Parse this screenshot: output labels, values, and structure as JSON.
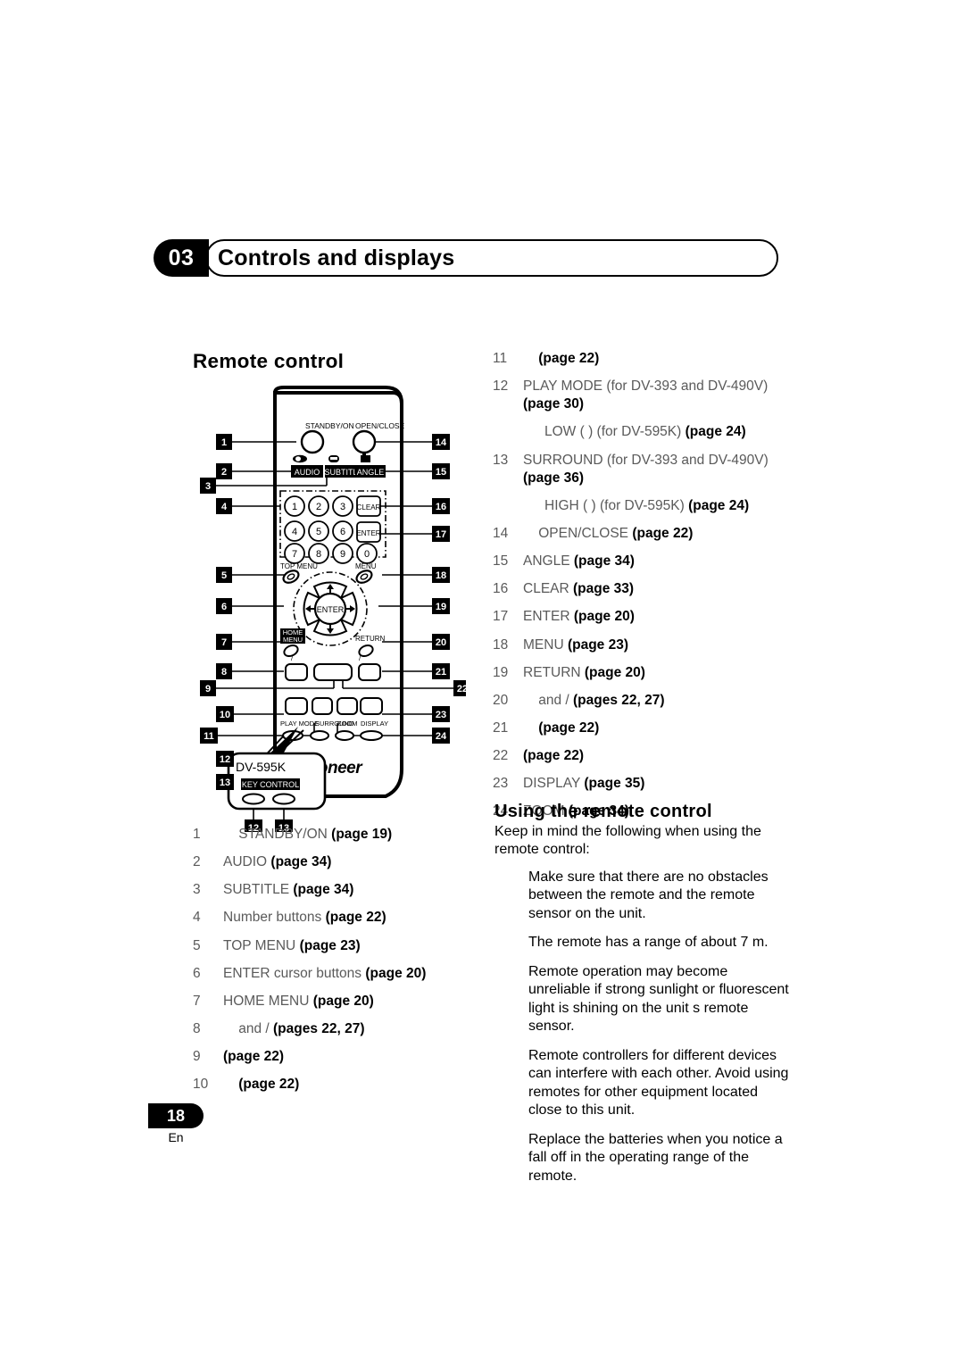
{
  "chapter": {
    "number": "03",
    "title": "Controls and displays"
  },
  "sections": {
    "remote_control": "Remote control",
    "using_remote_control": "Using the remote control"
  },
  "left_list": [
    {
      "n": "1",
      "text": "STANDBY/ON",
      "page": "(page 19)",
      "lead": true
    },
    {
      "n": "2",
      "text": "AUDIO",
      "page": "(page 34)"
    },
    {
      "n": "3",
      "text": "SUBTITLE",
      "page": "(page 34)"
    },
    {
      "n": "4",
      "text": "Number buttons",
      "page": "(page 22)"
    },
    {
      "n": "5",
      "text": "TOP MENU",
      "page": "(page 23)"
    },
    {
      "n": "6",
      "text": "ENTER    cursor buttons",
      "page": "(page 20)"
    },
    {
      "n": "7",
      "text": "HOME MENU",
      "page": "(page 20)"
    },
    {
      "n": "8",
      "text": "and  /",
      "page": "(pages 22, 27)",
      "lead": true
    },
    {
      "n": "9",
      "text": "",
      "page": "(page 22)"
    },
    {
      "n": "10",
      "text": "",
      "page": "(page 22)",
      "lead": true
    }
  ],
  "right_list": [
    {
      "n": "11",
      "text": "",
      "page": "(page 22)",
      "lead": true
    },
    {
      "n": "12",
      "text": "PLAY MODE (for DV-393 and DV-490V)",
      "page": "(page 30)",
      "wrap": true
    },
    {
      "n": "",
      "text": "LOW (  ) (for DV-595K)",
      "page": "(page 24)",
      "sub": true
    },
    {
      "n": "13",
      "text": "SURROUND (for DV-393 and DV-490V)",
      "page": "(page 36)",
      "wrap": true
    },
    {
      "n": "",
      "text": "HIGH (  ) (for DV-595K)",
      "page": "(page 24)",
      "sub": true
    },
    {
      "n": "14",
      "text": "OPEN/CLOSE",
      "page": "(page 22)",
      "lead": true
    },
    {
      "n": "15",
      "text": "ANGLE",
      "page": "(page 34)"
    },
    {
      "n": "16",
      "text": "CLEAR",
      "page": "(page 33)"
    },
    {
      "n": "17",
      "text": "ENTER",
      "page": "(page 20)"
    },
    {
      "n": "18",
      "text": "MENU",
      "page": "(page 23)"
    },
    {
      "n": "19",
      "text": "RETURN",
      "page": "(page 20)"
    },
    {
      "n": "20",
      "text": "and  /",
      "page": "(pages 22, 27)",
      "lead": true
    },
    {
      "n": "21",
      "text": "",
      "page": "(page 22)",
      "lead": true
    },
    {
      "n": "22",
      "text": "",
      "page": "(page 22)"
    },
    {
      "n": "23",
      "text": "DISPLAY",
      "page": "(page 35)"
    },
    {
      "n": "24",
      "text": "ZOOM",
      "page": "(page 34)"
    }
  ],
  "using_remote": {
    "intro": "Keep in mind the following when using the remote control:",
    "bullets": [
      "Make sure that there are no obstacles between the remote and the remote sensor on the unit.",
      "The remote has a range of about 7 m.",
      "Remote operation may become unreliable if strong sunlight or fluorescent light is shining on the unit s remote sensor.",
      "Remote controllers for different devices can interfere with each other. Avoid using remotes for other equipment located close to this unit.",
      "Replace the batteries when you notice a fall off in the operating range of the remote."
    ]
  },
  "footer": {
    "page_number": "18",
    "language": "En"
  },
  "remote_diagram": {
    "model": "DV-595K",
    "brand": "Pioneer",
    "key_control_label": "KEY CONTROL",
    "button_labels": {
      "standby_on": "STANDBY/ON",
      "open_close": "OPEN/CLOSE",
      "audio": "AUDIO",
      "subtitle": "SUBTITLE",
      "angle": "ANGLE",
      "clear": "CLEAR",
      "enter_small": "ENTER",
      "top_menu": "TOP MENU",
      "menu": "MENU",
      "enter": "ENTER",
      "home_menu_1": "HOME",
      "home_menu_2": "MENU",
      "return": "RETURN",
      "play_mode": "PLAY MODE",
      "surround": "SURROUND",
      "zoom": "ZOOM",
      "display": "DISPLAY"
    },
    "number_keys": [
      "1",
      "2",
      "3",
      "4",
      "5",
      "6",
      "7",
      "8",
      "9",
      "0"
    ],
    "callouts": [
      "1",
      "2",
      "3",
      "4",
      "5",
      "6",
      "7",
      "8",
      "9",
      "10",
      "11",
      "12",
      "13",
      "14",
      "15",
      "16",
      "17",
      "18",
      "19",
      "20",
      "21",
      "22",
      "23",
      "24"
    ],
    "inset_callouts": [
      "12",
      "13"
    ]
  },
  "colors": {
    "ink": "#000000",
    "muted_text": "#5a5a5a",
    "page_bg": "#ffffff"
  }
}
